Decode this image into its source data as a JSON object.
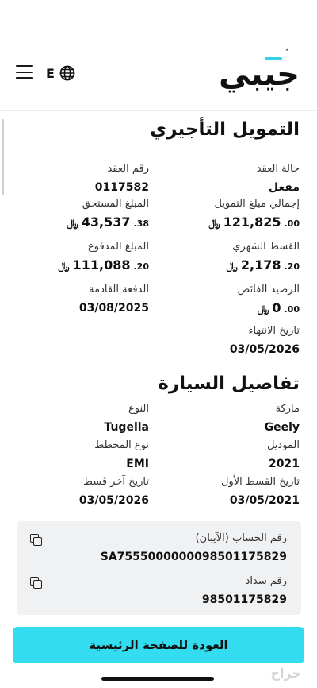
{
  "header": {
    "logo_text": "جيبي",
    "logo_dots": "ﹰ",
    "lang_label": "E",
    "accent_color": "#33dcef"
  },
  "lease": {
    "title": "التمويل التأجيري",
    "contract_status_label": "حالة العقد",
    "contract_status_value": "مفعل",
    "contract_number_label": "رقم العقد",
    "contract_number_value": "0117582",
    "total_financing_label": "إجمالي مبلغ التمويل",
    "total_financing_int": "121,825",
    "total_financing_cents": ".00",
    "amount_due_label": "المبلغ المستحق",
    "amount_due_int": "43,537",
    "amount_due_cents": ".38",
    "monthly_installment_label": "القسط الشهري",
    "monthly_installment_int": "2,178",
    "monthly_installment_cents": ".20",
    "amount_paid_label": "المبلغ المدفوع",
    "amount_paid_int": "111,088",
    "amount_paid_cents": ".20",
    "surplus_balance_label": "الرصيد الفائض",
    "surplus_balance_int": "0",
    "surplus_balance_cents": ".00",
    "next_payment_label": "الدفعة القادمة",
    "next_payment_value": "03/08/2025",
    "end_date_label": "تاريخ الانتهاء",
    "end_date_value": "03/05/2026",
    "currency_symbol": "﷼"
  },
  "car": {
    "title": "تفاصيل السيارة",
    "brand_label": "ماركة",
    "brand_value": "Geely",
    "type_label": "النوع",
    "type_value": "Tugella",
    "model_label": "الموديل",
    "model_value": "2021",
    "plan_type_label": "نوع المخطط",
    "plan_type_value": "EMI",
    "first_installment_label": "تاريخ القسط الأول",
    "first_installment_value": "03/05/2021",
    "last_installment_label": "تاريخ آخر قسط",
    "last_installment_value": "03/05/2026"
  },
  "account": {
    "iban_label": "رقم الحساب (الآيبان)",
    "iban_value": "SA7555000000098501175829",
    "sadad_label": "رقم سداد",
    "sadad_value": "98501175829"
  },
  "footer": {
    "home_button_label": "العودة للصفحة الرئيسية",
    "watermark": "حراج"
  }
}
